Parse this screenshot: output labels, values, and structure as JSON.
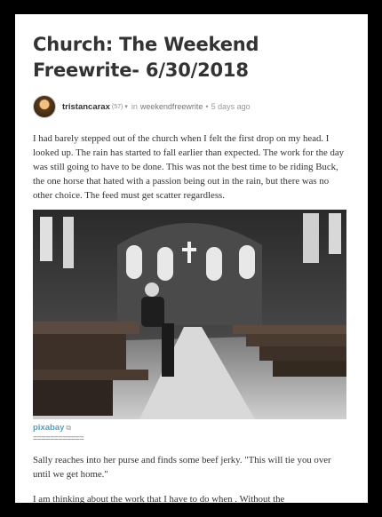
{
  "post": {
    "title": "Church: The Weekend Freewrite- 6/30/2018",
    "author": "tristancarax",
    "reputation": "(57)",
    "caret": "▾",
    "in_label": "in",
    "community": "weekendfreewrite",
    "dot": "•",
    "time": "5 days ago",
    "paragraph1": "I had barely stepped out of the church when I felt the first drop on my head. I looked up. The rain has started to fall earlier than expected. The work for the day was still going to have to be done. This was not the best time to be riding Buck, the one horse that hated with a passion being out in the rain, but there was no other choice. The feed must get scatter regardless.",
    "image_source": "pixabay",
    "external_link_icon": "external-link-icon",
    "separator": "============",
    "paragraph2": "Sally reaches into her purse and finds some beef jerky. \"This will tie you over until we get home.\"",
    "paragraph3_partial": "I am thinking about the work that I have to do when . Without the"
  },
  "colors": {
    "title": "#333333",
    "link": "#4fa3c7",
    "body_text": "#333333",
    "meta": "#777777"
  }
}
